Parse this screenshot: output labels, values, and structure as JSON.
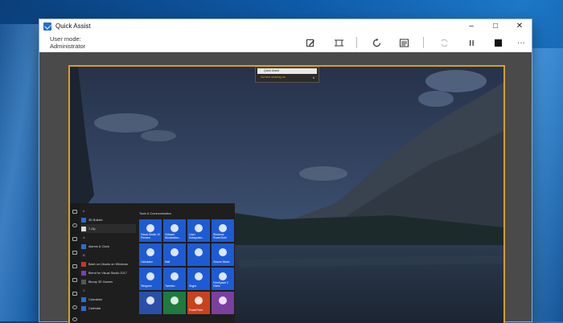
{
  "window": {
    "title": "Quick Assist",
    "minimize": "–",
    "maximize": "□",
    "close": "✕"
  },
  "toolbar": {
    "user_mode_label": "User mode:",
    "user_mode_value": "Administrator"
  },
  "remote": {
    "mini_window": {
      "title": "Quick Assist",
      "status": "Screen sharing on",
      "pause": "II"
    },
    "start_menu": {
      "apps": [
        {
          "label": "#",
          "letter": true
        },
        {
          "label": "3D Builder"
        },
        {
          "label": "7-Zip",
          "selected": true
        },
        {
          "label": "A",
          "letter": true
        },
        {
          "label": "Alarms & Clock"
        },
        {
          "label": "B",
          "letter": true
        },
        {
          "label": "Bash on Ubuntu on Windows"
        },
        {
          "label": "Blend for Visual Studio 2017"
        },
        {
          "label": "Bluray 3D Games"
        },
        {
          "label": "C",
          "letter": true
        },
        {
          "label": "Calculator"
        },
        {
          "label": "Calendar"
        }
      ],
      "tiles_heading": "Tools & Communication",
      "tiles": [
        {
          "label": "Visual Studio 15 Preview",
          "color": "#1e5bd3",
          "icon": "visual-studio-icon"
        },
        {
          "label": "VMware Workstation...",
          "color": "#1e5bd3",
          "icon": "vmware-icon"
        },
        {
          "label": "Linux Subsystem...",
          "color": "#1e5bd3",
          "icon": "linux-icon"
        },
        {
          "label": "Windows PowerShell",
          "color": "#1e5bd3",
          "icon": "powershell-icon"
        },
        {
          "label": "Calculator",
          "color": "#1e5bd3",
          "icon": "calculator-icon"
        },
        {
          "label": "Mail",
          "color": "#1e5bd3",
          "icon": "mail-icon"
        },
        {
          "label": "",
          "color": "#1e5bd3",
          "icon": "mail-envelope-icon"
        },
        {
          "label": "Groove Music",
          "color": "#1e5bd3",
          "icon": "groove-music-icon"
        },
        {
          "label": "Telegram",
          "color": "#1e5bd3",
          "icon": "telegram-icon"
        },
        {
          "label": "Tweeten",
          "color": "#1e5bd3",
          "icon": "tweeten-icon"
        },
        {
          "label": "Skype",
          "color": "#1e5bd3",
          "icon": "skype-icon"
        },
        {
          "label": "FreeSpace 2 Client",
          "color": "#1e5bd3",
          "icon": "app-icon"
        },
        {
          "label": "",
          "color": "#2b4fa8",
          "icon": "onenote-icon"
        },
        {
          "label": "",
          "color": "#1f7a3f",
          "icon": "excel-icon"
        },
        {
          "label": "PowerPoint",
          "color": "#c8421f",
          "icon": "powerpoint-icon"
        },
        {
          "label": "",
          "color": "#7b3f9e",
          "icon": "onenote-purple-icon"
        }
      ]
    }
  },
  "colors": {
    "accent_border": "#d3a127",
    "titlebar_accent": "#1f6fd0",
    "status_orange": "#e89a2d"
  }
}
